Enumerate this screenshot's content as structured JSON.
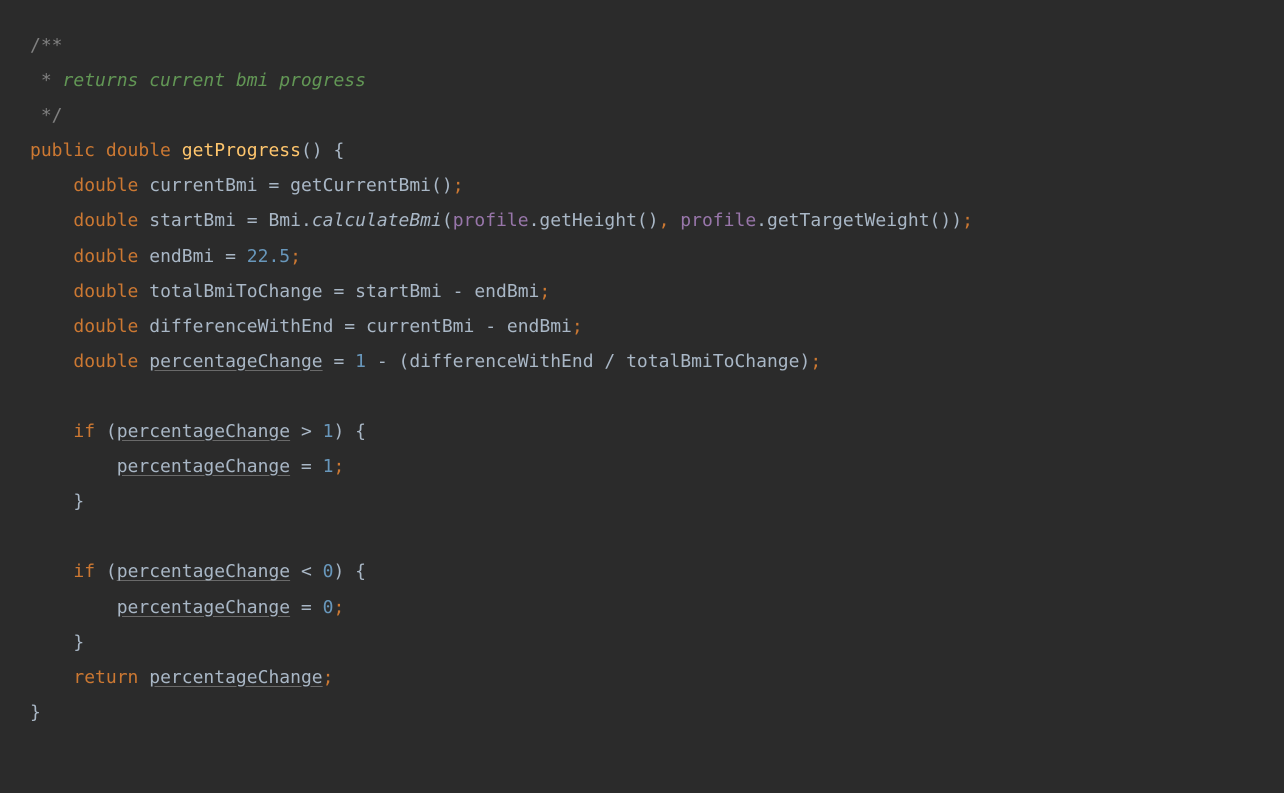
{
  "code": {
    "line1": {
      "comment_open": "/**"
    },
    "line2": {
      "prefix": " * ",
      "text": "returns current bmi progress"
    },
    "line3": {
      "comment_close": " */"
    },
    "line4": {
      "kw_public": "public",
      "kw_double": "double",
      "method_name": "getProgress",
      "parens": "()",
      "brace": " {"
    },
    "line5": {
      "kw_double": "double",
      "var": "currentBmi",
      "eq": " = ",
      "call": "getCurrentBmi()",
      "semi": ";"
    },
    "line6": {
      "kw_double": "double",
      "var": "startBmi",
      "eq": " = ",
      "class": "Bmi",
      "dot": ".",
      "static_method": "calculateBmi",
      "paren_open": "(",
      "field1": "profile",
      "call1": ".getHeight()",
      "comma": ",",
      "sp": " ",
      "field2": "profile",
      "call2": ".getTargetWeight()",
      "paren_close": ")",
      "semi": ";"
    },
    "line7": {
      "kw_double": "double",
      "var": "endBmi",
      "eq": " = ",
      "num": "22.5",
      "semi": ";"
    },
    "line8": {
      "kw_double": "double",
      "var": "totalBmiToChange",
      "eq": " = ",
      "expr": "startBmi - endBmi",
      "semi": ";"
    },
    "line9": {
      "kw_double": "double",
      "var": "differenceWithEnd",
      "eq": " = ",
      "expr": "currentBmi - endBmi",
      "semi": ";"
    },
    "line10": {
      "kw_double": "double",
      "var": "percentageChange",
      "eq": " = ",
      "num": "1",
      "rest": " - (differenceWithEnd / totalBmiToChange)",
      "semi": ";"
    },
    "line12": {
      "kw_if": "if",
      "paren_open": " (",
      "var": "percentageChange",
      "op": " > ",
      "num": "1",
      "paren_close": ")",
      "brace": " {"
    },
    "line13": {
      "var": "percentageChange",
      "eq": " = ",
      "num": "1",
      "semi": ";"
    },
    "line14": {
      "brace": "}"
    },
    "line16": {
      "kw_if": "if",
      "paren_open": " (",
      "var": "percentageChange",
      "op": " < ",
      "num": "0",
      "paren_close": ")",
      "brace": " {"
    },
    "line17": {
      "var": "percentageChange",
      "eq": " = ",
      "num": "0",
      "semi": ";"
    },
    "line18": {
      "brace": "}"
    },
    "line19": {
      "kw_return": "return",
      "sp": " ",
      "var": "percentageChange",
      "semi": ";"
    },
    "line20": {
      "brace": "}"
    }
  }
}
